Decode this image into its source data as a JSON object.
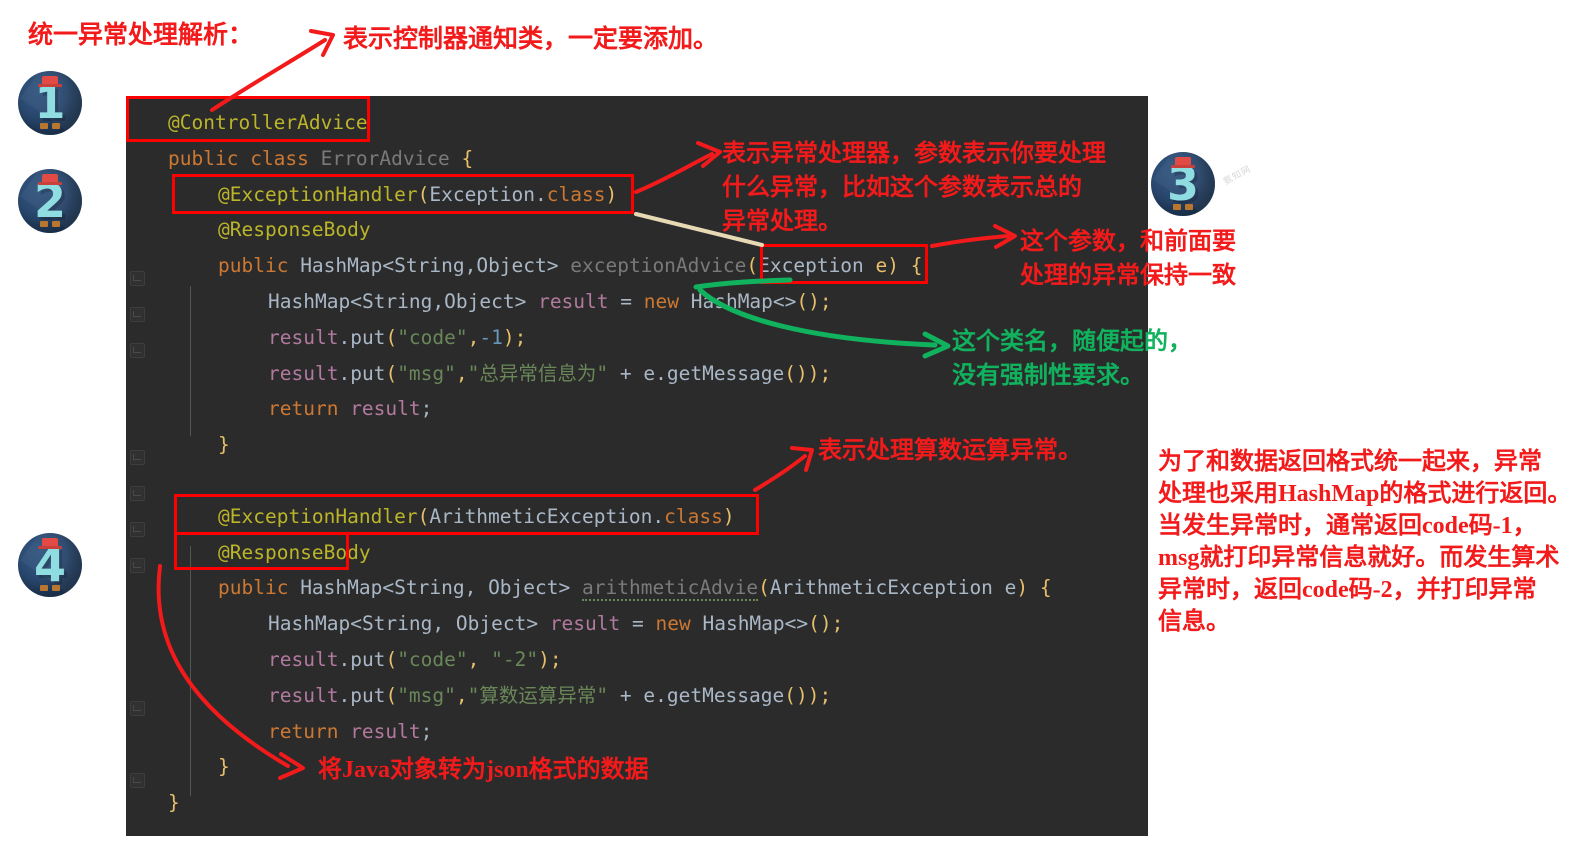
{
  "page": {
    "title": "统一异常处理解析：",
    "bg": "#ffffff",
    "code_bg": "#2b2b2b",
    "red": "#f21a1a",
    "green": "#11b25e"
  },
  "badges": [
    {
      "name": "badge-1",
      "label": "1"
    },
    {
      "name": "badge-2",
      "label": "2"
    },
    {
      "name": "badge-3",
      "label": "3"
    },
    {
      "name": "badge-4",
      "label": "4"
    }
  ],
  "watermark": "氨知网",
  "code": {
    "lines": [
      {
        "id": "l1",
        "indent": 0,
        "tokens": [
          {
            "t": "@ControllerAdvice",
            "c": "anno"
          }
        ]
      },
      {
        "id": "l2",
        "indent": 0,
        "tokens": [
          {
            "t": "public ",
            "c": "kw"
          },
          {
            "t": "class ",
            "c": "kw"
          },
          {
            "t": "ErrorAdvice",
            "c": "fnd"
          },
          {
            "t": " ",
            "c": "pln"
          },
          {
            "t": "{",
            "c": "pr1"
          }
        ]
      },
      {
        "id": "l3",
        "indent": 1,
        "tokens": [
          {
            "t": "@ExceptionHandler",
            "c": "anno"
          },
          {
            "t": "(",
            "c": "pr1"
          },
          {
            "t": "Exception",
            "c": "cls"
          },
          {
            "t": ".",
            "c": "pln"
          },
          {
            "t": "class",
            "c": "kw"
          },
          {
            "t": ")",
            "c": "pr1"
          }
        ]
      },
      {
        "id": "l4",
        "indent": 1,
        "tokens": [
          {
            "t": "@ResponseBody",
            "c": "anno"
          }
        ]
      },
      {
        "id": "l5",
        "indent": 1,
        "tokens": [
          {
            "t": "public ",
            "c": "kw"
          },
          {
            "t": "HashMap",
            "c": "cls"
          },
          {
            "t": "<",
            "c": "pln"
          },
          {
            "t": "String",
            "c": "cls"
          },
          {
            "t": ",",
            "c": "pln"
          },
          {
            "t": "Object",
            "c": "cls"
          },
          {
            "t": "> ",
            "c": "pln"
          },
          {
            "t": "exceptionAdvice",
            "c": "fnd"
          },
          {
            "t": "(",
            "c": "pr1"
          },
          {
            "t": "Exception ",
            "c": "cls"
          },
          {
            "t": "e",
            "c": "pr1"
          },
          {
            "t": ")",
            "c": "pr1"
          },
          {
            "t": " ",
            "c": "pln"
          },
          {
            "t": "{",
            "c": "pr1"
          }
        ]
      },
      {
        "id": "l6",
        "indent": 2,
        "tokens": [
          {
            "t": "HashMap",
            "c": "cls"
          },
          {
            "t": "<",
            "c": "pln"
          },
          {
            "t": "String",
            "c": "cls"
          },
          {
            "t": ",",
            "c": "pln"
          },
          {
            "t": "Object",
            "c": "cls"
          },
          {
            "t": "> ",
            "c": "pln"
          },
          {
            "t": "result",
            "c": "var"
          },
          {
            "t": " = ",
            "c": "pln"
          },
          {
            "t": "new ",
            "c": "kw"
          },
          {
            "t": "HashMap",
            "c": "cls"
          },
          {
            "t": "<>",
            "c": "pln"
          },
          {
            "t": "()",
            "c": "pr1"
          },
          {
            "t": ";",
            "c": "pr1"
          }
        ]
      },
      {
        "id": "l7",
        "indent": 2,
        "tokens": [
          {
            "t": "result",
            "c": "var"
          },
          {
            "t": ".",
            "c": "pln"
          },
          {
            "t": "put",
            "c": "pln"
          },
          {
            "t": "(",
            "c": "pr1"
          },
          {
            "t": "\"code\"",
            "c": "str"
          },
          {
            "t": ",",
            "c": "pr1"
          },
          {
            "t": "-1",
            "c": "num"
          },
          {
            "t": ")",
            "c": "pr1"
          },
          {
            "t": ";",
            "c": "pr1"
          }
        ]
      },
      {
        "id": "l8",
        "indent": 2,
        "tokens": [
          {
            "t": "result",
            "c": "var"
          },
          {
            "t": ".",
            "c": "pln"
          },
          {
            "t": "put",
            "c": "pln"
          },
          {
            "t": "(",
            "c": "pr1"
          },
          {
            "t": "\"msg\"",
            "c": "str"
          },
          {
            "t": ",",
            "c": "pr1"
          },
          {
            "t": "\"总异常信息为\"",
            "c": "str"
          },
          {
            "t": " + ",
            "c": "pln"
          },
          {
            "t": "e",
            "c": "pln"
          },
          {
            "t": ".",
            "c": "pln"
          },
          {
            "t": "getMessage",
            "c": "pln"
          },
          {
            "t": "())",
            "c": "pr1"
          },
          {
            "t": ";",
            "c": "pr1"
          }
        ]
      },
      {
        "id": "l9",
        "indent": 2,
        "tokens": [
          {
            "t": "return ",
            "c": "kw"
          },
          {
            "t": "result",
            "c": "var"
          },
          {
            "t": ";",
            "c": "pln"
          }
        ]
      },
      {
        "id": "l10",
        "indent": 1,
        "tokens": [
          {
            "t": "}",
            "c": "pr1"
          }
        ]
      },
      {
        "id": "l11",
        "indent": 0,
        "tokens": []
      },
      {
        "id": "l12",
        "indent": 1,
        "tokens": [
          {
            "t": "@ExceptionHandler",
            "c": "anno"
          },
          {
            "t": "(",
            "c": "pr1"
          },
          {
            "t": "ArithmeticException",
            "c": "cls"
          },
          {
            "t": ".",
            "c": "pln"
          },
          {
            "t": "class",
            "c": "kw"
          },
          {
            "t": ")",
            "c": "pr1"
          }
        ]
      },
      {
        "id": "l13",
        "indent": 1,
        "tokens": [
          {
            "t": "@ResponseBody",
            "c": "anno"
          }
        ]
      },
      {
        "id": "l14",
        "indent": 1,
        "tokens": [
          {
            "t": "public ",
            "c": "kw"
          },
          {
            "t": "HashMap",
            "c": "cls"
          },
          {
            "t": "<",
            "c": "pln"
          },
          {
            "t": "String",
            "c": "cls"
          },
          {
            "t": ", ",
            "c": "pln"
          },
          {
            "t": "Object",
            "c": "cls"
          },
          {
            "t": "> ",
            "c": "pln"
          },
          {
            "t": "arithmeticAdvie",
            "c": "fnd typo"
          },
          {
            "t": "(",
            "c": "pr1"
          },
          {
            "t": "ArithmeticException ",
            "c": "cls"
          },
          {
            "t": "e",
            "c": "pln"
          },
          {
            "t": ")",
            "c": "pr1"
          },
          {
            "t": " ",
            "c": "pln"
          },
          {
            "t": "{",
            "c": "pr1"
          }
        ]
      },
      {
        "id": "l15",
        "indent": 2,
        "tokens": [
          {
            "t": "HashMap",
            "c": "cls"
          },
          {
            "t": "<",
            "c": "pln"
          },
          {
            "t": "String",
            "c": "cls"
          },
          {
            "t": ", ",
            "c": "pln"
          },
          {
            "t": "Object",
            "c": "cls"
          },
          {
            "t": "> ",
            "c": "pln"
          },
          {
            "t": "result",
            "c": "var"
          },
          {
            "t": " = ",
            "c": "pln"
          },
          {
            "t": "new ",
            "c": "kw"
          },
          {
            "t": "HashMap",
            "c": "cls"
          },
          {
            "t": "<>",
            "c": "pln"
          },
          {
            "t": "()",
            "c": "pr1"
          },
          {
            "t": ";",
            "c": "pr1"
          }
        ]
      },
      {
        "id": "l16",
        "indent": 2,
        "tokens": [
          {
            "t": "result",
            "c": "var"
          },
          {
            "t": ".",
            "c": "pln"
          },
          {
            "t": "put",
            "c": "pln"
          },
          {
            "t": "(",
            "c": "pr1"
          },
          {
            "t": "\"code\"",
            "c": "str"
          },
          {
            "t": ", ",
            "c": "pr1"
          },
          {
            "t": "\"-2\"",
            "c": "str"
          },
          {
            "t": ")",
            "c": "pr1"
          },
          {
            "t": ";",
            "c": "pr1"
          }
        ]
      },
      {
        "id": "l17",
        "indent": 2,
        "tokens": [
          {
            "t": "result",
            "c": "var"
          },
          {
            "t": ".",
            "c": "pln"
          },
          {
            "t": "put",
            "c": "pln"
          },
          {
            "t": "(",
            "c": "pr1"
          },
          {
            "t": "\"msg\"",
            "c": "str"
          },
          {
            "t": ",",
            "c": "pr1"
          },
          {
            "t": "\"算数运算异常\"",
            "c": "str"
          },
          {
            "t": " + ",
            "c": "pln"
          },
          {
            "t": "e",
            "c": "pln"
          },
          {
            "t": ".",
            "c": "pln"
          },
          {
            "t": "getMessage",
            "c": "pln"
          },
          {
            "t": "())",
            "c": "pr1"
          },
          {
            "t": ";",
            "c": "pr1"
          }
        ]
      },
      {
        "id": "l18",
        "indent": 2,
        "tokens": [
          {
            "t": "return ",
            "c": "kw"
          },
          {
            "t": "result",
            "c": "var"
          },
          {
            "t": ";",
            "c": "pln"
          }
        ]
      },
      {
        "id": "l19",
        "indent": 1,
        "tokens": [
          {
            "t": "}",
            "c": "pr1"
          }
        ]
      },
      {
        "id": "l20",
        "indent": 0,
        "tokens": [
          {
            "t": "}",
            "c": "pr1"
          }
        ]
      }
    ]
  },
  "annotations": {
    "title": "统一异常处理解析：",
    "a1": "表示控制器通知类，一定要添加。",
    "a2": "表示异常处理器，参数表示你要处理\n什么异常，比如这个参数表示总的\n异常处理。",
    "a3": "这个参数，和前面要\n处理的异常保持一致",
    "a4": "这个类名，随便起的，\n没有强制性要求。",
    "a5": "表示处理算数运算异常。",
    "a6": "将Java对象转为json格式的数据",
    "a7": "为了和数据返回格式统一起来，异常\n处理也采用HashMap的格式进行返回。\n当发生异常时，通常返回code码-1，\nmsg就打印异常信息就好。而发生算术\n异常时，返回code码-2，并打印异常\n信息。"
  }
}
